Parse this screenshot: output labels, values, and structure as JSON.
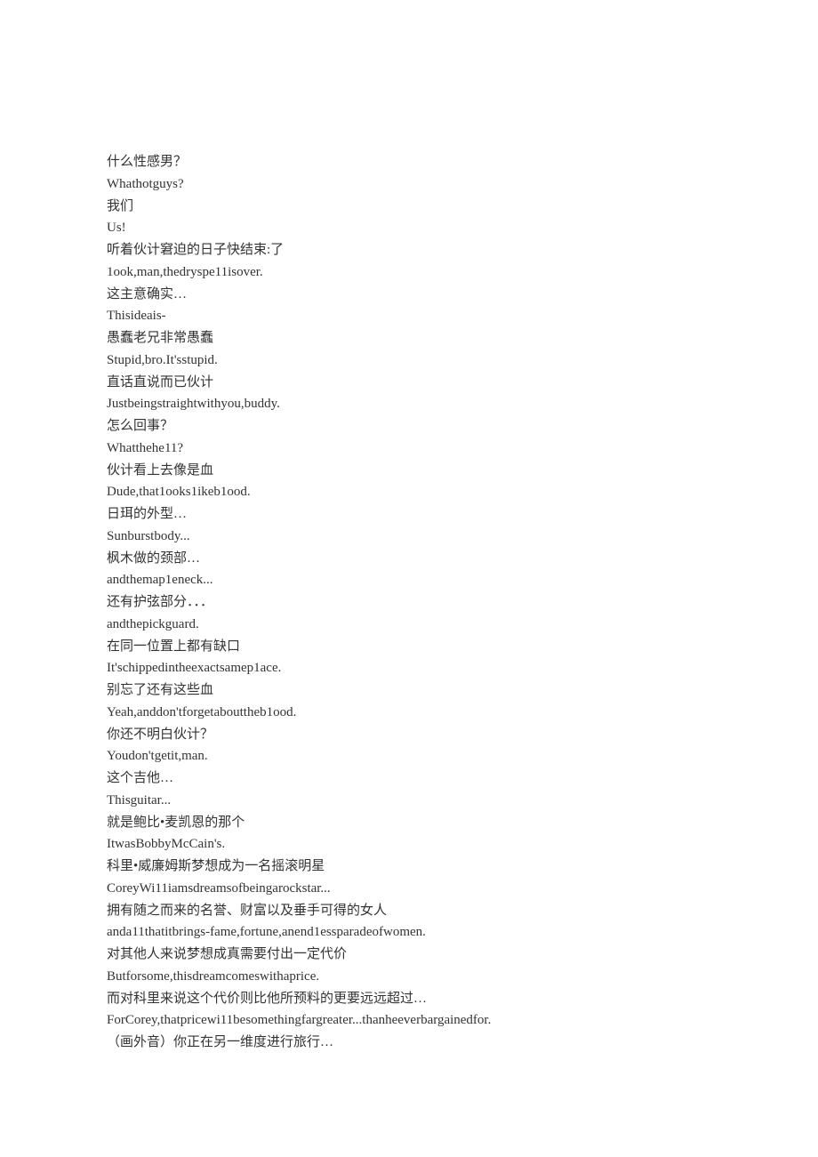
{
  "lines": [
    "什么性感男？",
    "Whathotguys?",
    "我们",
    "Us!",
    "听着伙计窘迫的日子快结束:了",
    "1ook,man,thedryspe11isover.",
    "这主意确实…",
    "Thisideais-",
    "愚蠢老兄非常愚蠢",
    "Stupid,bro.It'sstupid.",
    "直话直说而已伙计",
    "Justbeingstraightwithyou,buddy.",
    "怎么回事？",
    "Whatthehe11?",
    "伙计看上去像是血",
    "Dude,that1ooks1ikeb1ood.",
    "日珥的外型…",
    "Sunburstbody...",
    "枫木做的颈部…",
    "andthemap1eneck...",
    "还有护弦部分．．．",
    "andthepickguard.",
    "在同一位置上都有缺口",
    "It'schippedintheexactsamep1ace.",
    "别忘了还有这些血",
    "Yeah,anddon'tforgetabouttheb1ood.",
    "你还不明白伙计？",
    "Youdon'tgetit,man.",
    "这个吉他…",
    "Thisguitar...",
    "就是鲍比•麦凯恩的那个",
    "ItwasBobbyMcCain's.",
    "科里•威廉姆斯梦想成为一名摇滚明星",
    "CoreyWi11iamsdreamsofbeingarockstar...",
    "拥有随之而来的名誉、财富以及垂手可得的女人",
    "anda11thatitbrings-fame,fortune,anend1essparadeofwomen.",
    "对其他人来说梦想成真需要付出一定代价",
    "Butforsome,thisdreamcomeswithaprice.",
    "而对科里来说这个代价则比他所预料的更要远远超过…",
    "ForCorey,thatpricewi11besomethingfargreater...thanheeverbargainedfor.",
    "（画外音）你正在另一维度进行旅行…"
  ]
}
